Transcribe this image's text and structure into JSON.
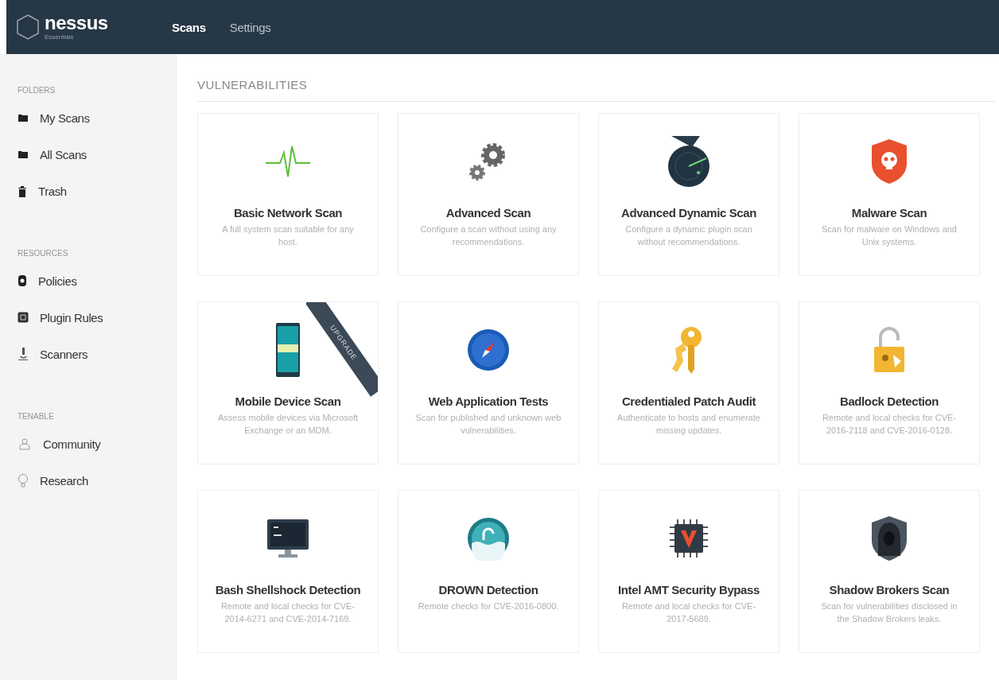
{
  "logo": {
    "name": "nessus",
    "edition": "Essentials"
  },
  "nav": [
    {
      "label": "Scans",
      "selected": true
    },
    {
      "label": "Settings",
      "selected": false
    }
  ],
  "sidebar": [
    {
      "heading": "FOLDERS",
      "items": [
        "My Scans",
        "All Scans",
        "Trash"
      ]
    },
    {
      "heading": "RESOURCES",
      "items": [
        "Policies",
        "Plugin Rules",
        "Scanners"
      ]
    },
    {
      "heading": "TENABLE",
      "items": [
        "Community",
        "Research"
      ]
    }
  ],
  "section_title": "VULNERABILITIES",
  "templates": [
    {
      "title": "Basic Network Scan",
      "description": "A full system scan suitable for any host."
    },
    {
      "title": "Advanced Scan",
      "description": "Configure a scan without using any recommendations."
    },
    {
      "title": "Advanced Dynamic Scan",
      "description": "Configure a dynamic plugin scan without recommendations."
    },
    {
      "title": "Malware Scan",
      "description": "Scan for malware on Windows and Unix systems."
    },
    {
      "title": "Mobile Device Scan",
      "description": "Assess mobile devices via Microsoft Exchange or an MDM.",
      "ribbon": "UPGRADE"
    },
    {
      "title": "Web Application Tests",
      "description": "Scan for published and unknown web vulnerabilities."
    },
    {
      "title": "Credentialed Patch Audit",
      "description": "Authenticate to hosts and enumerate missing updates."
    },
    {
      "title": "Badlock Detection",
      "description": "Remote and local checks for CVE-2016-2118 and CVE-2016-0128."
    },
    {
      "title": "Bash Shellshock Detection",
      "description": "Remote and local checks for CVE-2014-6271 and CVE-2014-7169."
    },
    {
      "title": "DROWN Detection",
      "description": "Remote checks for CVE-2016-0800."
    },
    {
      "title": "Intel AMT Security Bypass",
      "description": "Remote and local checks for CVE-2017-5689."
    },
    {
      "title": "Shadow Brokers Scan",
      "description": "Scan for vulnerabilities disclosed in the Shadow Brokers leaks."
    }
  ]
}
